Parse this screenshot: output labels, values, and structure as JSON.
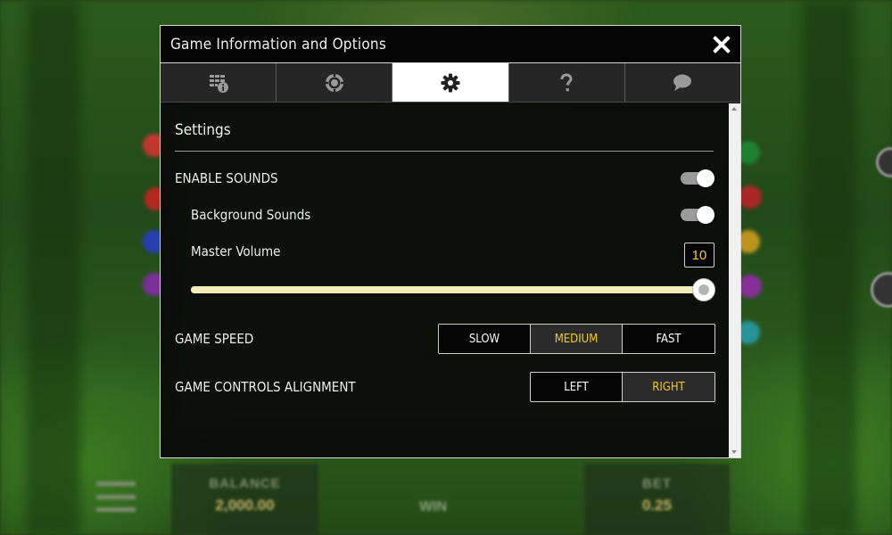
{
  "dialog": {
    "title": "Game Information and Options",
    "close_icon": "close-icon",
    "tabs": [
      {
        "icon": "paytable-info-icon",
        "active": false
      },
      {
        "icon": "chip-rules-icon",
        "active": false
      },
      {
        "icon": "gear-icon",
        "active": true
      },
      {
        "icon": "question-icon",
        "active": false
      },
      {
        "icon": "chat-icon",
        "active": false
      }
    ]
  },
  "settings": {
    "heading": "Settings",
    "enable_sounds": {
      "label": "ENABLE SOUNDS",
      "on": true
    },
    "background_sounds": {
      "label": "Background Sounds",
      "on": true
    },
    "master_volume": {
      "label": "Master Volume",
      "value": "10",
      "level": 1.0
    },
    "game_speed": {
      "label": "GAME SPEED",
      "options": [
        "SLOW",
        "MEDIUM",
        "FAST"
      ],
      "selected": "MEDIUM"
    },
    "alignment": {
      "label": "GAME CONTROLS ALIGNMENT",
      "options": [
        "LEFT",
        "RIGHT"
      ],
      "selected": "RIGHT"
    }
  },
  "colors": {
    "accent": "#f3c623",
    "slider_track": "#f2ecb8",
    "dialog_bg": "#080808"
  },
  "background": {
    "balance_label": "BALANCE",
    "balance_value": "2,000.00",
    "win_label": "WIN",
    "bet_label": "BET",
    "bet_value": "0.25"
  }
}
